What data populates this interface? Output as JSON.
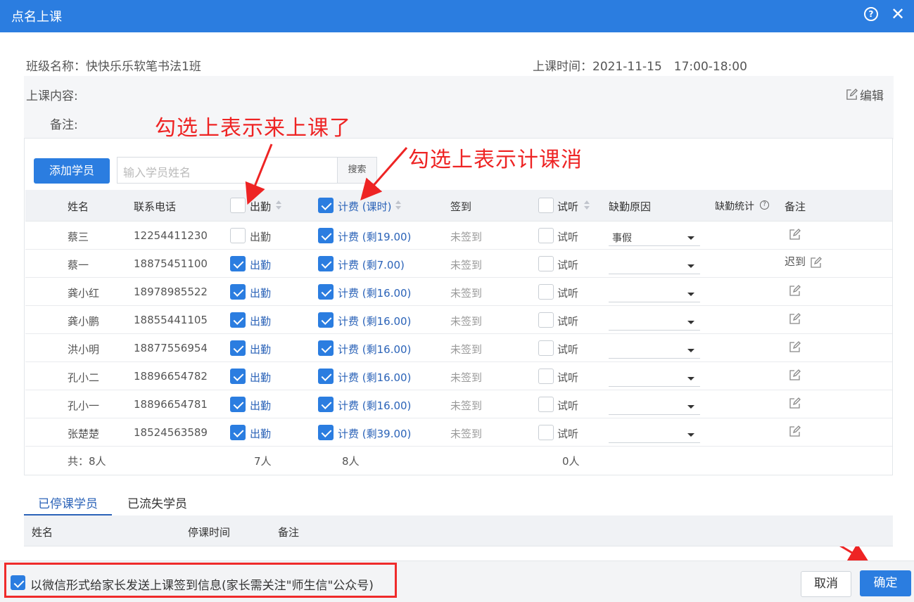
{
  "dialog": {
    "title": "点名上课"
  },
  "info": {
    "class_name": "班级名称：快快乐乐软笔书法1班",
    "class_time": "上课时间：2021-11-15　17:00-18:00",
    "content_label": "上课内容:",
    "edit_label": "编辑",
    "remark_label": "备注:"
  },
  "annotations": {
    "attend": "勾选上表示来上课了",
    "charge": "勾选上表示计课消"
  },
  "toolbar": {
    "add_student": "添加学员",
    "search_placeholder": "输入学员姓名",
    "search_button": "搜索"
  },
  "table": {
    "headers": {
      "name": "姓名",
      "phone": "联系电话",
      "attend": "出勤",
      "charge": "计费 (课时)",
      "sign": "签到",
      "trial": "试听",
      "absent_reason": "缺勤原因",
      "absent_stats": "缺勤统计",
      "note": "备注"
    },
    "rows": [
      {
        "name": "蔡三",
        "phone": "12254411230",
        "attend_label": "出勤",
        "charge_label": "计费 (剩19.00)",
        "sign": "未签到",
        "trial_label": "试听",
        "reason": "事假",
        "note": ""
      },
      {
        "name": "蔡一",
        "phone": "18875451100",
        "attend_label": "出勤",
        "charge_label": "计费 (剩7.00)",
        "sign": "未签到",
        "trial_label": "试听",
        "reason": "",
        "note": "迟到"
      },
      {
        "name": "龚小红",
        "phone": "18978985522",
        "attend_label": "出勤",
        "charge_label": "计费 (剩16.00)",
        "sign": "未签到",
        "trial_label": "试听",
        "reason": "",
        "note": ""
      },
      {
        "name": "龚小鹏",
        "phone": "18855441105",
        "attend_label": "出勤",
        "charge_label": "计费 (剩16.00)",
        "sign": "未签到",
        "trial_label": "试听",
        "reason": "",
        "note": ""
      },
      {
        "name": "洪小明",
        "phone": "18877556954",
        "attend_label": "出勤",
        "charge_label": "计费 (剩16.00)",
        "sign": "未签到",
        "trial_label": "试听",
        "reason": "",
        "note": ""
      },
      {
        "name": "孔小二",
        "phone": "18896654782",
        "attend_label": "出勤",
        "charge_label": "计费 (剩16.00)",
        "sign": "未签到",
        "trial_label": "试听",
        "reason": "",
        "note": ""
      },
      {
        "name": "孔小一",
        "phone": "18896654781",
        "attend_label": "出勤",
        "charge_label": "计费 (剩16.00)",
        "sign": "未签到",
        "trial_label": "试听",
        "reason": "",
        "note": ""
      },
      {
        "name": "张楚楚",
        "phone": "18524563589",
        "attend_label": "出勤",
        "charge_label": "计费 (剩39.00)",
        "sign": "未签到",
        "trial_label": "试听",
        "reason": "",
        "note": ""
      }
    ],
    "footer": {
      "total": "共：8人",
      "attend_count": "7人",
      "charge_count": "8人",
      "trial_count": "0人"
    }
  },
  "tabs": {
    "stopped": "已停课学员",
    "lost": "已流失学员"
  },
  "table2": {
    "headers": {
      "name": "姓名",
      "stop_time": "停课时间",
      "note": "备注"
    }
  },
  "footer": {
    "wechat_notify": "以微信形式给家长发送上课签到信息(家长需关注\"师生信\"公众号)",
    "cancel": "取消",
    "confirm": "确定"
  },
  "colors": {
    "primary": "#2b7de0",
    "link": "#2b63b8",
    "annotation": "#ee2424"
  },
  "state": {
    "attend_header_checked": false,
    "charge_header_checked": true,
    "trial_header_checked": false,
    "attend_checked": [
      false,
      true,
      true,
      true,
      true,
      true,
      true,
      true
    ],
    "charge_checked": [
      true,
      true,
      true,
      true,
      true,
      true,
      true,
      true
    ],
    "trial_checked": [
      false,
      false,
      false,
      false,
      false,
      false,
      false,
      false
    ],
    "wechat_notify_checked": true
  }
}
